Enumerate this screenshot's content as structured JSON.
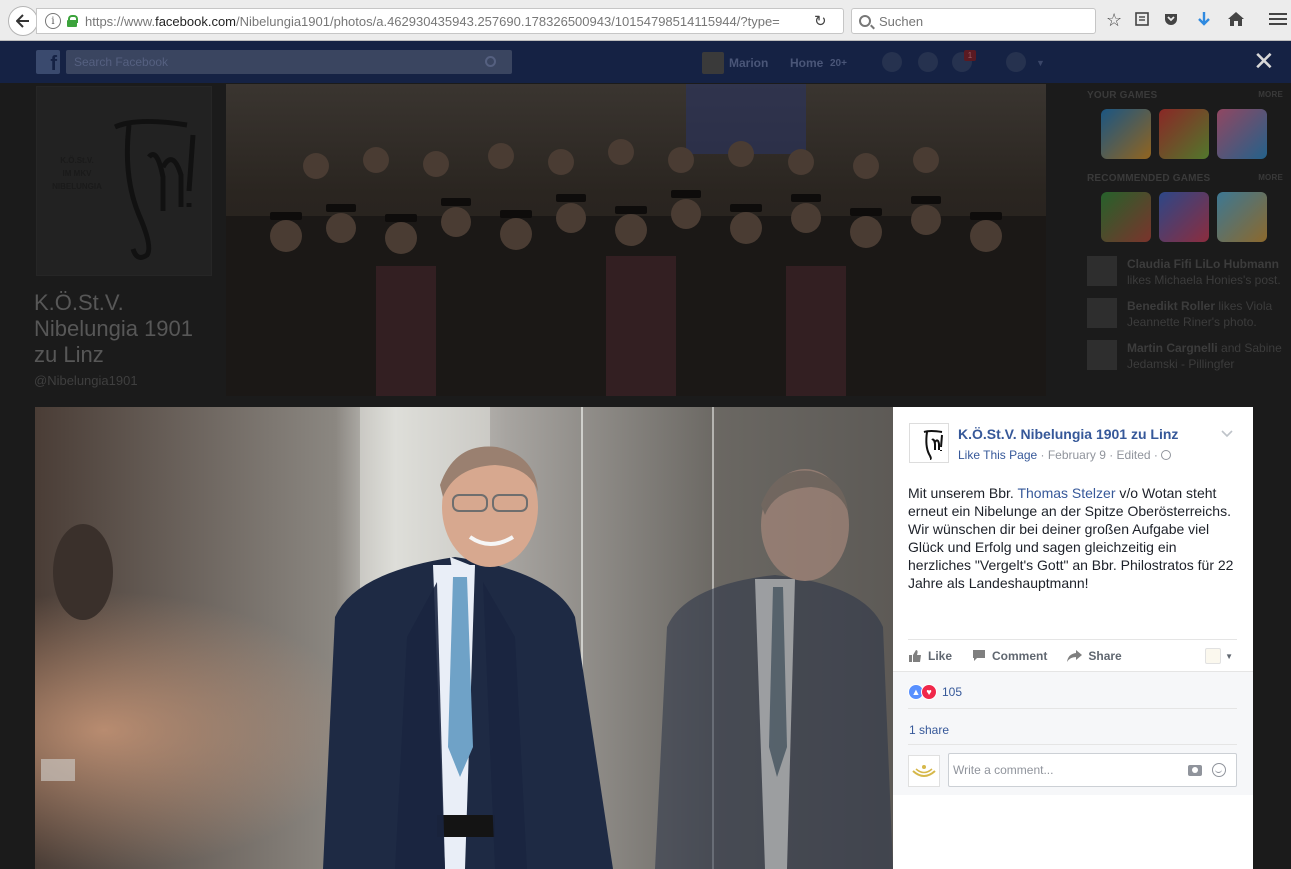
{
  "browser": {
    "url_prefix": "https://www.",
    "url_domain": "facebook.com",
    "url_path": "/Nibelungia1901/photos/a.462930435943.257690.178326500943/10154798514115944/?type=",
    "search_placeholder": "Suchen"
  },
  "fb_header": {
    "search_placeholder": "Search Facebook",
    "user_name": "Marion",
    "home_label": "Home",
    "home_count": "20+",
    "notifications_badge": "1"
  },
  "page": {
    "logo_text": "K.Ö.St.V.\nIM MKV\nNIBELUNGIA",
    "name": "K.Ö.St.V. Nibelungia 1901 zu Linz",
    "handle": "@Nibelungia1901"
  },
  "right_column": {
    "your_games_title": "YOUR GAMES",
    "more_label": "MORE",
    "recommended_title": "RECOMMENDED GAMES",
    "ticker": [
      {
        "actor": "Claudia Fifi LiLo Hubmann",
        "text": " likes Michaela Honies's post."
      },
      {
        "actor": "Benedikt Roller",
        "text": " likes Viola Jeannette Riner's photo."
      },
      {
        "actor": "Martin Cargnelli",
        "text": " and Sabine Jedamski - Pillingfer"
      }
    ]
  },
  "post": {
    "page_name": "K.Ö.St.V. Nibelungia 1901 zu Linz",
    "like_page": "Like This Page",
    "date": " · February 9 · Edited · ",
    "text_before": "Mit unserem Bbr. ",
    "mention": "Thomas Stelzer",
    "text_after": " v/o Wotan steht erneut ein Nibelunge an der Spitze Oberösterreichs. Wir wünschen dir bei deiner großen Aufgabe viel Glück und Erfolg und sagen gleichzeitig ein herzliches \"Vergelt's Gott\" an Bbr. Philostratos für 22 Jahre als Landeshauptmann!",
    "actions": {
      "like": "Like",
      "comment": "Comment",
      "share": "Share"
    },
    "reaction_count": "105",
    "shares": "1 share",
    "comment_placeholder": "Write a comment..."
  },
  "colors": {
    "fb_link": "#365899",
    "fb_header_dimmed": "#152244",
    "text": "#1d2129",
    "meta": "#90949c"
  }
}
